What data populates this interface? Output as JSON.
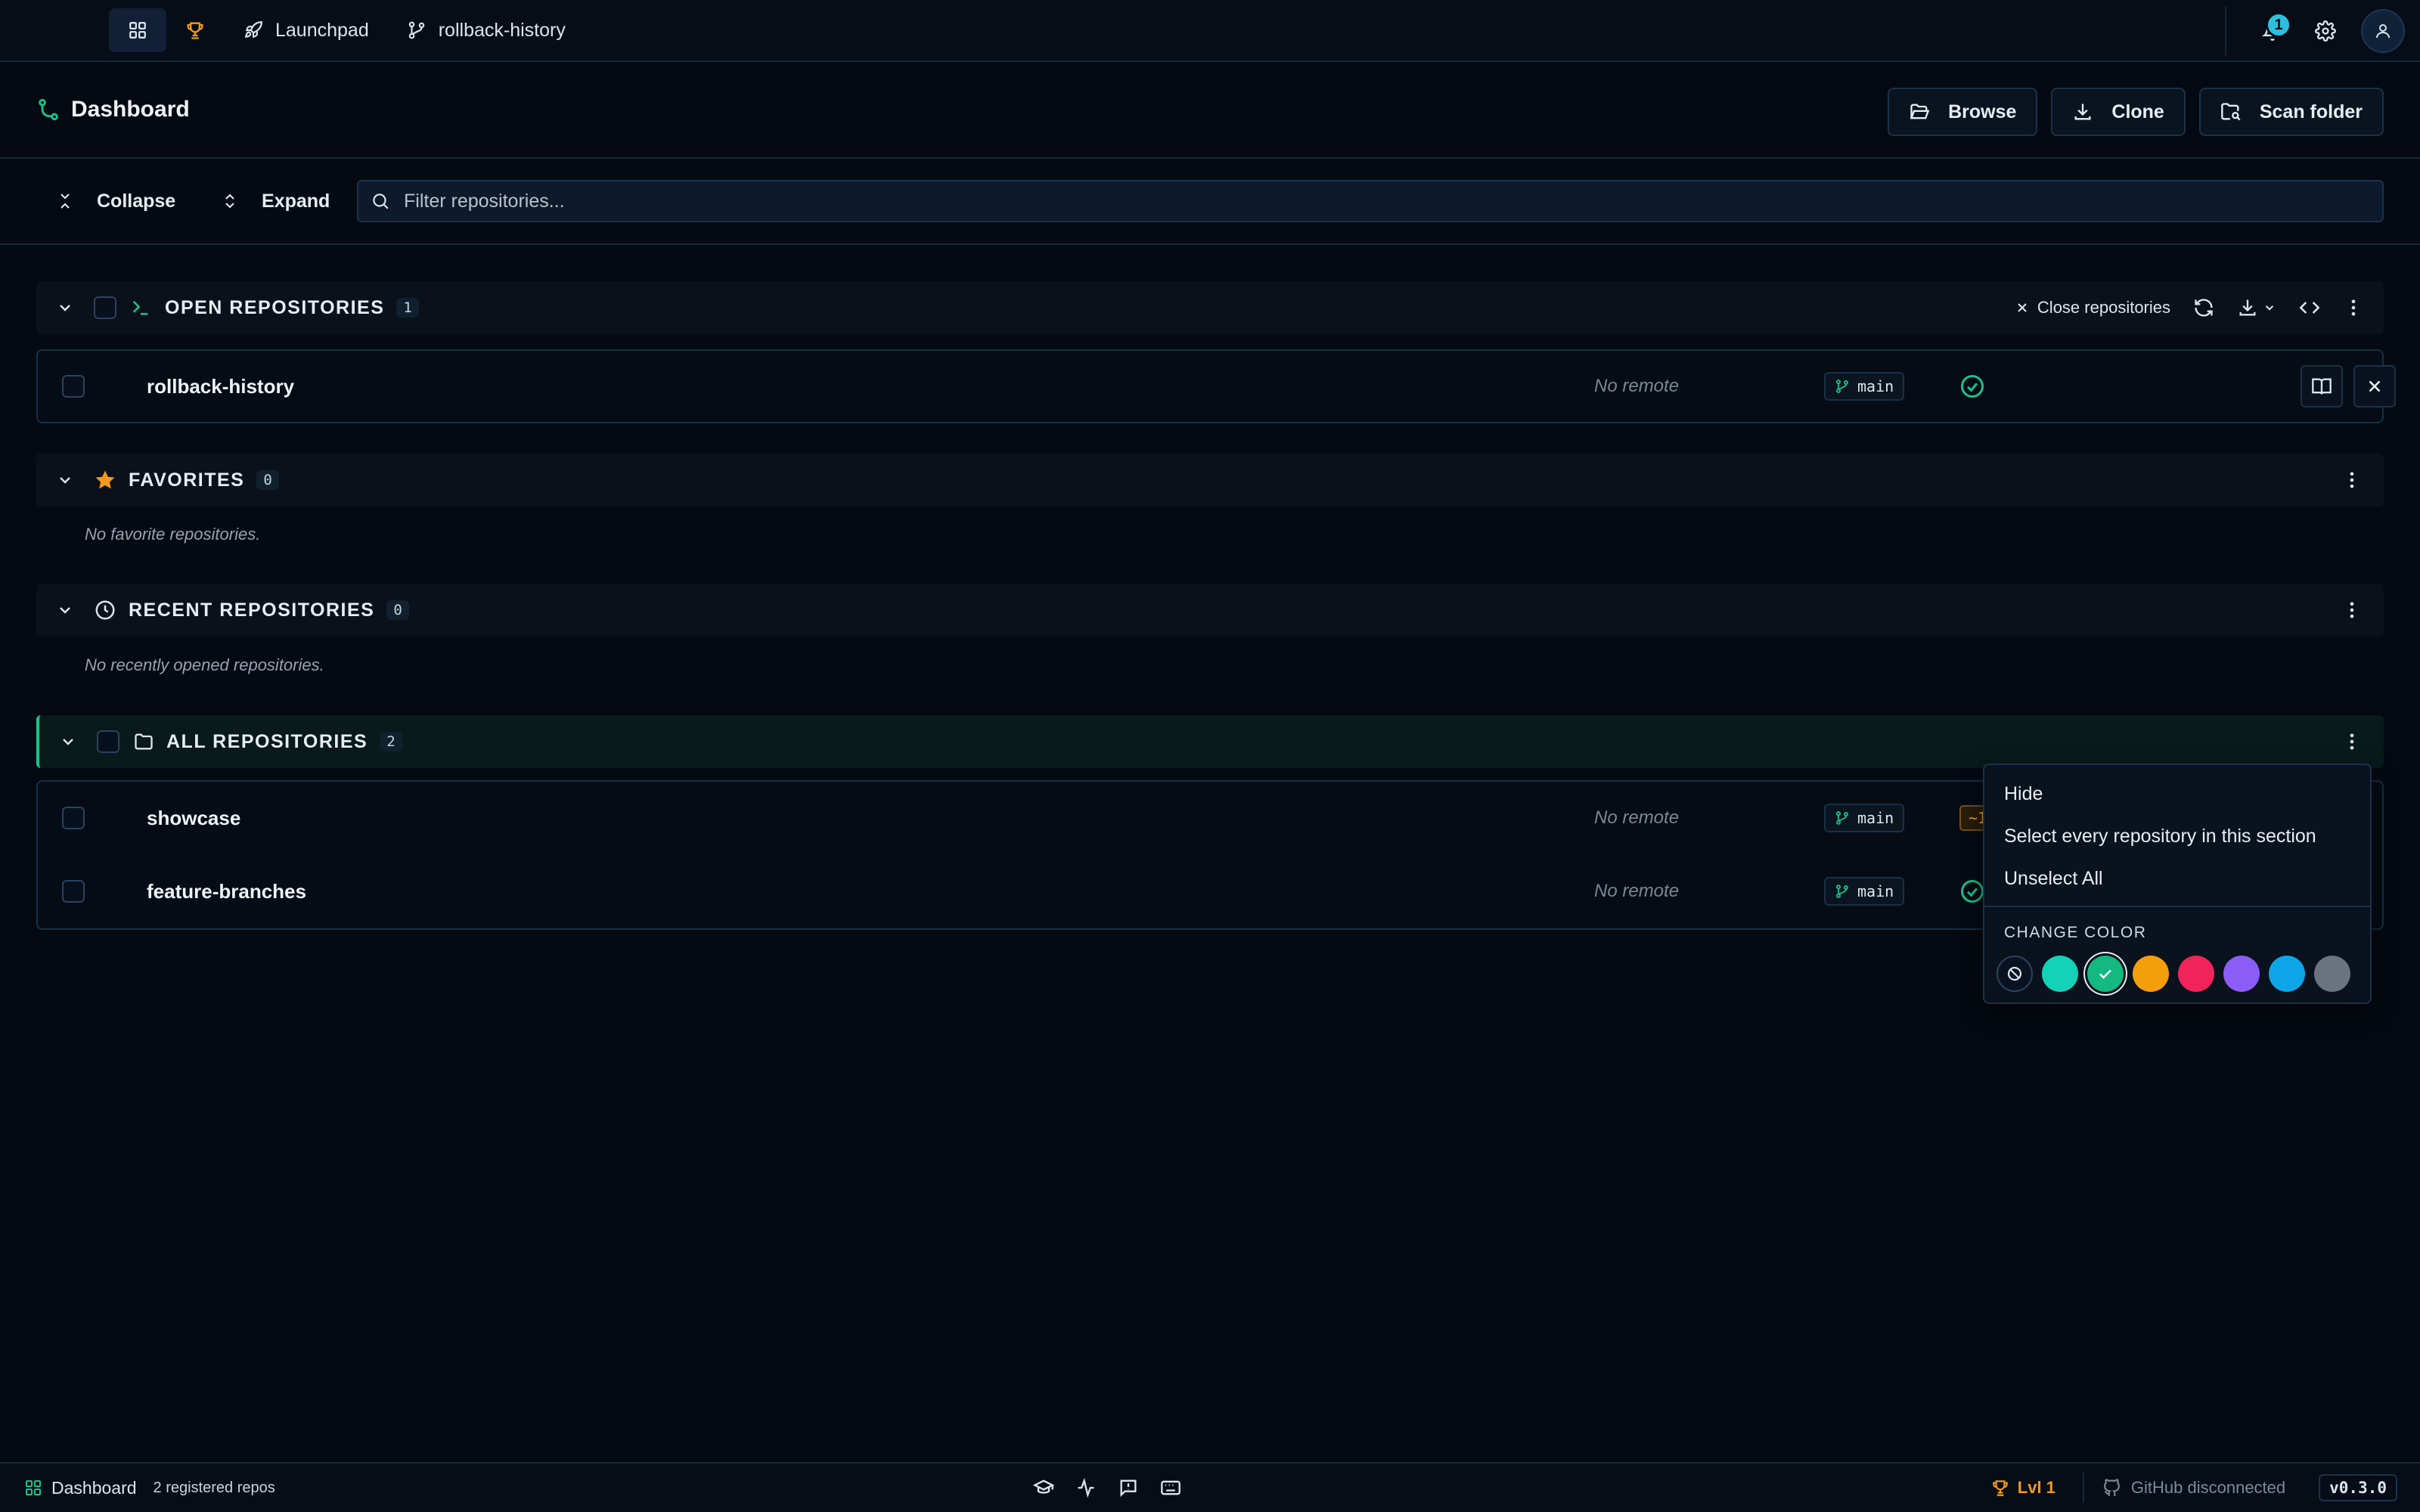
{
  "topbar": {
    "tabs": [
      {
        "label": "Launchpad",
        "icon": "rocket-icon"
      },
      {
        "label": "rollback-history",
        "icon": "git-branch-icon"
      }
    ],
    "notification_count": "1"
  },
  "header": {
    "title": "Dashboard",
    "actions": [
      {
        "label": "Browse",
        "icon": "folder-open-icon"
      },
      {
        "label": "Clone",
        "icon": "download-icon"
      },
      {
        "label": "Scan folder",
        "icon": "folder-search-icon"
      }
    ]
  },
  "toolbar": {
    "collapse_label": "Collapse",
    "expand_label": "Expand",
    "filter_placeholder": "Filter repositories..."
  },
  "sections": {
    "open": {
      "title": "OPEN REPOSITORIES",
      "count": "1",
      "close_label": "Close repositories",
      "repos": [
        {
          "name": "rollback-history",
          "remote": "No remote",
          "branch": "main",
          "status": "clean"
        }
      ]
    },
    "favorites": {
      "title": "FAVORITES",
      "count": "0",
      "empty": "No favorite repositories."
    },
    "recent": {
      "title": "RECENT REPOSITORIES",
      "count": "0",
      "empty": "No recently opened repositories."
    },
    "all": {
      "title": "ALL REPOSITORIES",
      "count": "2",
      "repos": [
        {
          "name": "showcase",
          "remote": "No remote",
          "branch": "main",
          "status": "~1"
        },
        {
          "name": "feature-branches",
          "remote": "No remote",
          "branch": "main",
          "status": "clean"
        }
      ]
    }
  },
  "context_menu": {
    "items": [
      "Hide",
      "Select every repository in this section",
      "Unselect All"
    ],
    "color_label": "CHANGE COLOR",
    "colors": [
      "#13d2b8",
      "#13b981",
      "#f59e0b",
      "#f0245a",
      "#8b5cf6",
      "#0ea5e9",
      "#6b7280"
    ],
    "selected_color": "#13b981"
  },
  "statusbar": {
    "view": "Dashboard",
    "repos": "2 registered repos",
    "level": "Lvl 1",
    "github": "GitHub disconnected",
    "version": "v0.3.0"
  },
  "colors": {
    "accent": "#19c28a",
    "warning": "#f29a1b",
    "background": "#050a12"
  }
}
